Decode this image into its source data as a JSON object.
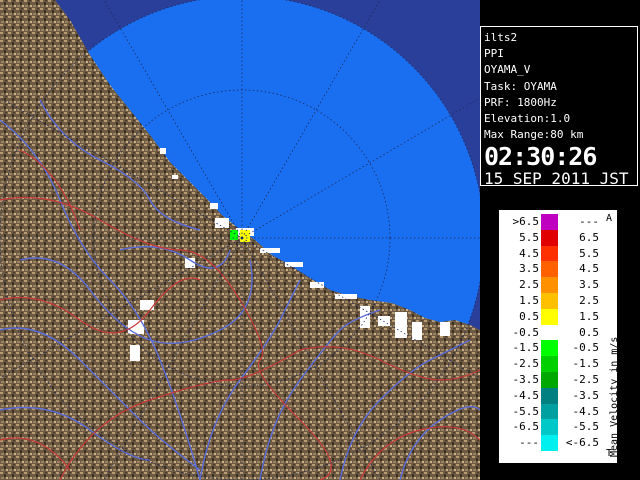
{
  "info": {
    "site_code": "ilts2",
    "scan_type": "PPI",
    "product": "OYAMA_V",
    "task": "Task: OYAMA",
    "prf": "PRF: 1800Hz",
    "elevation": "Elevation:1.0",
    "max_range": "Max Range:80 km",
    "time": "02:30:26",
    "date": "15 SEP 2011 JST"
  },
  "legend": {
    "title": "Mean Velocity in m/s",
    "top_mark": "A",
    "bottom_mark": "T",
    "rows": [
      {
        "lo": ">6.5",
        "hi": "---",
        "color": "#c000c0"
      },
      {
        "lo": "5.5",
        "hi": "6.5",
        "color": "#e00000"
      },
      {
        "lo": "4.5",
        "hi": "5.5",
        "color": "#ff3000"
      },
      {
        "lo": "3.5",
        "hi": "4.5",
        "color": "#ff6000"
      },
      {
        "lo": "2.5",
        "hi": "3.5",
        "color": "#ff9000"
      },
      {
        "lo": "1.5",
        "hi": "2.5",
        "color": "#ffc000"
      },
      {
        "lo": "0.5",
        "hi": "1.5",
        "color": "#ffff00"
      },
      {
        "lo": "-0.5",
        "hi": "0.5",
        "color": "#ffffff"
      },
      {
        "lo": "-1.5",
        "hi": "-0.5",
        "color": "#00ff00"
      },
      {
        "lo": "-2.5",
        "hi": "-1.5",
        "color": "#00d000"
      },
      {
        "lo": "-3.5",
        "hi": "-2.5",
        "color": "#00a800"
      },
      {
        "lo": "-4.5",
        "hi": "-3.5",
        "color": "#008080"
      },
      {
        "lo": "-5.5",
        "hi": "-4.5",
        "color": "#00a0a0"
      },
      {
        "lo": "-6.5",
        "hi": "-5.5",
        "color": "#00c8c8"
      },
      {
        "lo": "---",
        "hi": "<-6.5",
        "color": "#00f0f0"
      }
    ]
  },
  "colors": {
    "outer_sea": "#2a3f9a",
    "inner_sea": "#1a6ff0",
    "terrain": "#6b5840",
    "terrain_light": "#b39a74",
    "river": "#5a6cd8",
    "boundary": "#c83a3a"
  }
}
